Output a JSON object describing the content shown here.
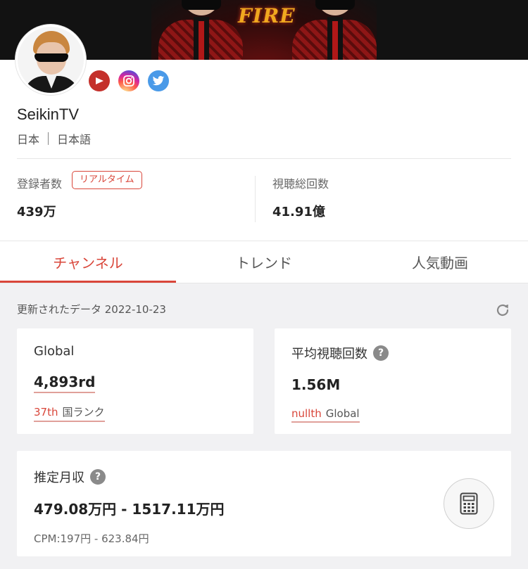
{
  "banner": {
    "art_text": "FIRE"
  },
  "channel": {
    "name": "SeikinTV",
    "country": "日本",
    "language": "日本語",
    "social_icons": [
      "youtube-icon",
      "instagram-icon",
      "twitter-icon"
    ]
  },
  "stats": {
    "subscribers_label": "登録者数",
    "realtime_badge": "リアルタイム",
    "subscribers_value": "439万",
    "views_label": "視聴総回数",
    "views_value": "41.91億"
  },
  "tabs": [
    {
      "label": "チャンネル",
      "active": true
    },
    {
      "label": "トレンド",
      "active": false
    },
    {
      "label": "人気動画",
      "active": false
    }
  ],
  "updated": {
    "text": "更新されたデータ 2022-10-23"
  },
  "cards": {
    "global": {
      "title": "Global",
      "value": "4,893rd",
      "sub_rank": "37th",
      "sub_label": "国ランク"
    },
    "avg_views": {
      "title": "平均視聴回数",
      "help": "?",
      "value": "1.56M",
      "sub_rank": "nullth",
      "sub_label": "Global"
    },
    "income": {
      "title": "推定月収",
      "help": "?",
      "value": "479.08万円 - 1517.11万円",
      "cpm": "CPM:197円 - 623.84円"
    }
  },
  "colors": {
    "accent": "#d9463a",
    "background_gray": "#f1f1f3"
  }
}
